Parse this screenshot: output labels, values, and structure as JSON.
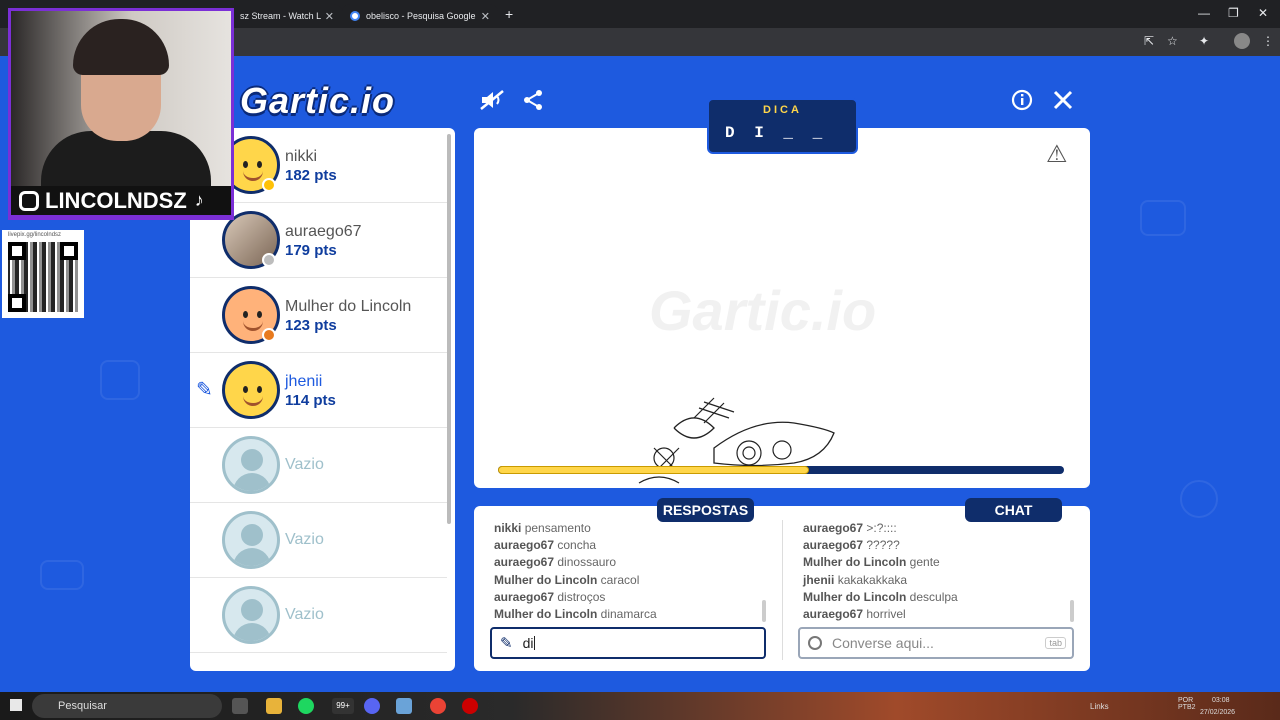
{
  "browser": {
    "tabs": [
      {
        "label": "sz Stream - Watch Live",
        "close": "✕"
      },
      {
        "label": "obelisco - Pesquisa Google",
        "close": "✕"
      }
    ],
    "new_tab": "+"
  },
  "overlay": {
    "handle": "LINCOLNDSZ",
    "qr_label": "livepix.gg/lincolndsz"
  },
  "game": {
    "logo": "Gartic.io",
    "hint": {
      "title": "DICA",
      "word": "D I _ _ _ _ _ _ _ _"
    },
    "timer_fraction": 0.55,
    "players": [
      {
        "name": "nikki",
        "points": "182 pts",
        "status_color": "#ffc107"
      },
      {
        "name": "auraego67",
        "points": "179 pts",
        "status_color": "#bdbdbd"
      },
      {
        "name": "Mulher do Lincoln",
        "points": "123 pts",
        "status_color": "#e87a1e"
      },
      {
        "name": "jhenii",
        "points": "114 pts",
        "status_color": ""
      },
      {
        "name": "Vazio",
        "points": ""
      },
      {
        "name": "Vazio",
        "points": ""
      },
      {
        "name": "Vazio",
        "points": ""
      }
    ],
    "answers_label": "RESPOSTAS",
    "chat_label": "CHAT",
    "answers": [
      {
        "user": "nikki",
        "text": "pensamento"
      },
      {
        "user": "auraego67",
        "text": "concha"
      },
      {
        "user": "auraego67",
        "text": "dinossauro"
      },
      {
        "user": "Mulher do Lincoln",
        "text": "caracol"
      },
      {
        "user": "auraego67",
        "text": "distroços"
      },
      {
        "user": "Mulher do Lincoln",
        "text": "dinamarca"
      }
    ],
    "chat": [
      {
        "user": "auraego67",
        "text": ">:?::::"
      },
      {
        "user": "auraego67",
        "text": "?????"
      },
      {
        "user": "Mulher do Lincoln",
        "text": "gente"
      },
      {
        "user": "jhenii",
        "text": "kakakakkaka"
      },
      {
        "user": "Mulher do Lincoln",
        "text": "desculpa"
      },
      {
        "user": "auraego67",
        "text": "horrivel"
      }
    ],
    "answer_input": {
      "value": "di"
    },
    "chat_input": {
      "placeholder": "Converse aqui...",
      "key_hint": "tab"
    }
  },
  "taskbar": {
    "search": "Pesquisar",
    "badge": "99+",
    "links": "Links",
    "lang": "POR PTB2",
    "time": "03:08",
    "date": "27/02/2026"
  },
  "colors": {
    "page_bg": "#1e5adf",
    "navy": "#0f2d6b",
    "accent_yellow": "#ffd64a",
    "overlay_border": "#7b2fd6"
  }
}
